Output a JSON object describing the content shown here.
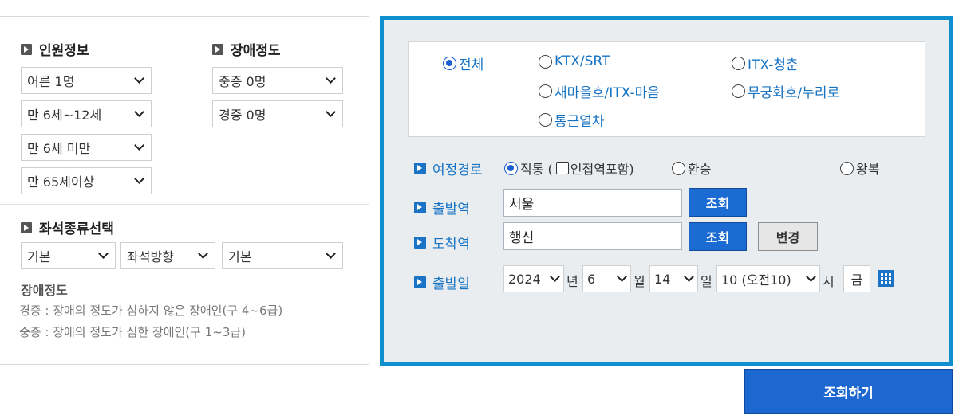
{
  "passenger": {
    "header": "인원정보",
    "selects": [
      "어른 1명",
      "만 6세~12세",
      "만 6세 미만",
      "만 65세이상"
    ]
  },
  "disability": {
    "header": "장애정도",
    "selects": [
      "중증 0명",
      "경증 0명"
    ]
  },
  "seat": {
    "header": "좌석종류선택",
    "selects": [
      "기본",
      "좌석방향",
      "기본"
    ]
  },
  "notes": {
    "title": "장애정도",
    "lines": [
      "경증 : 장애의 정도가 심하지 않은 장애인(구 4~6급)",
      "중증 : 장애의 정도가 심한 장애인(구 1~3급)"
    ]
  },
  "train_types": {
    "options": [
      "전체",
      "KTX/SRT",
      "ITX-청춘",
      "새마을호/ITX-마음",
      "무궁화호/누리로",
      "통근열차"
    ],
    "selected": "전체"
  },
  "route": {
    "label": "여정경로",
    "direct": "직통 (",
    "adjacent": "인접역포함)",
    "transfer": "환승",
    "roundtrip": "왕복"
  },
  "departure": {
    "label": "출발역",
    "value": "서울",
    "button": "조회"
  },
  "arrival": {
    "label": "도착역",
    "value": "행신",
    "button": "조회",
    "change_button": "변경"
  },
  "date": {
    "label": "출발일",
    "year": "2024",
    "year_unit": "년",
    "month": "6",
    "month_unit": "월",
    "day": "14",
    "day_unit": "일",
    "hour": "10 (오전10)",
    "hour_unit": "시",
    "weekday": "금"
  },
  "search_button": "조회하기",
  "colors": {
    "accent_blue": "#0f8fce",
    "button_blue": "#1c6bd3",
    "link_blue": "#1673c4"
  }
}
